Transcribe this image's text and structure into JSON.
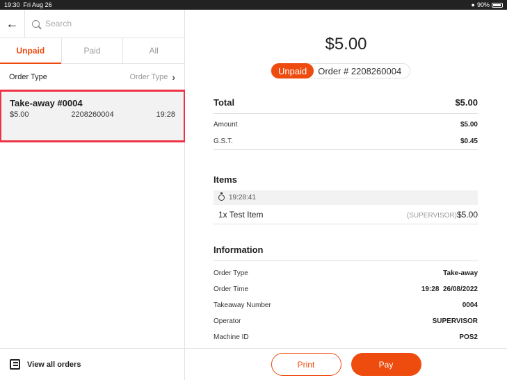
{
  "status_bar": {
    "time": "19:30",
    "date": "Fri Aug 26",
    "battery": "90%",
    "battery_level": 0.9
  },
  "search": {
    "placeholder": "Search"
  },
  "tabs": [
    {
      "label": "Unpaid",
      "active": true
    },
    {
      "label": "Paid",
      "active": false
    },
    {
      "label": "All",
      "active": false
    }
  ],
  "filter": {
    "label": "Order Type",
    "value": "Order Type"
  },
  "orders": [
    {
      "title": "Take-away #0004",
      "amount": "$5.00",
      "order_no": "2208260004",
      "time": "19:28",
      "selected": true
    }
  ],
  "bottom_left": {
    "view_all_label": "View all orders"
  },
  "detail": {
    "amount": "$5.00",
    "status": "Unpaid",
    "order_number": "Order # 2208260004",
    "total": {
      "label": "Total",
      "value": "$5.00"
    },
    "amount_row": {
      "label": "Amount",
      "value": "$5.00"
    },
    "gst_row": {
      "label": "G.S.T.",
      "value": "$0.45"
    },
    "items": {
      "heading": "Items",
      "time": "19:28:41",
      "list": [
        {
          "name": "1x Test Item",
          "by": "(SUPERVISOR)",
          "price": "$5.00"
        }
      ]
    },
    "information": {
      "heading": "Information",
      "rows": [
        {
          "label": "Order Type",
          "value": "Take-away"
        },
        {
          "label": "Order Time",
          "value": "19:28  26/08/2022"
        },
        {
          "label": "Takeaway Number",
          "value": "0004"
        },
        {
          "label": "Operator",
          "value": "SUPERVISOR"
        },
        {
          "label": "Machine ID",
          "value": "POS2"
        }
      ]
    }
  },
  "actions": {
    "print_label": "Print",
    "pay_label": "Pay"
  },
  "colors": {
    "accent": "#ee4b0e",
    "selection_outline": "#ee3346"
  }
}
